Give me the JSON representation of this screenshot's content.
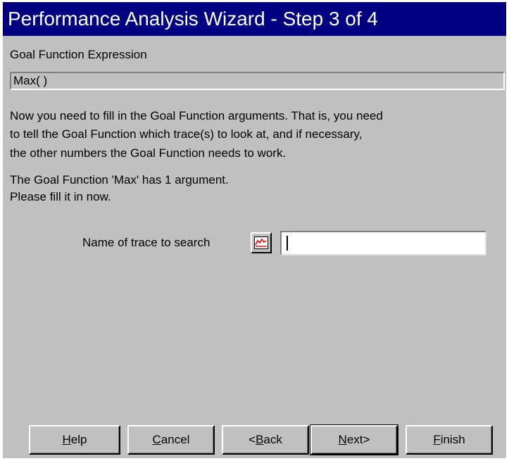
{
  "window": {
    "title": "Performance Analysis Wizard - Step 3 of 4"
  },
  "expression": {
    "label": "Goal Function Expression",
    "value": "Max( )"
  },
  "instructions": {
    "line1": "Now you need to fill in the Goal Function arguments.  That is, you need",
    "line2": "to tell the Goal Function which trace(s) to look at, and if necessary,",
    "line3": "the other numbers the Goal Function needs to work."
  },
  "argument_info": {
    "line1": "The Goal Function 'Max' has 1 argument.",
    "line2": "Please fill it in now."
  },
  "trace_field": {
    "label": "Name of trace to search",
    "value": "",
    "browse_icon": "trace-waveform-icon"
  },
  "buttons": {
    "help": {
      "accel": "H",
      "rest": "elp"
    },
    "cancel": {
      "accel": "C",
      "rest": "ancel"
    },
    "back": {
      "pre": "<",
      "accel": "B",
      "rest": "ack"
    },
    "next": {
      "accel": "N",
      "rest": "ext>"
    },
    "finish": {
      "accel": "F",
      "rest": "inish"
    }
  },
  "colors": {
    "titlebar": "#000080",
    "face": "#c0c0c0",
    "trace_icon": "#ff0000"
  }
}
